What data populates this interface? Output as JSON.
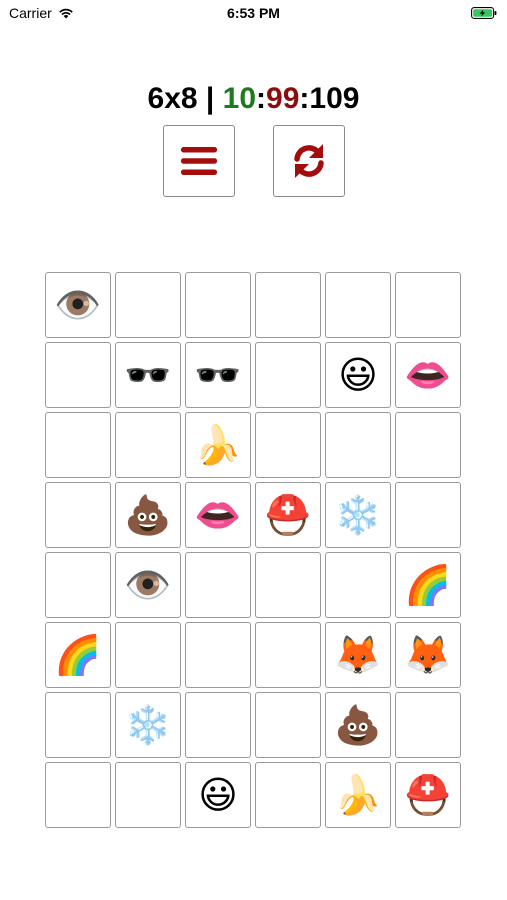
{
  "status_bar": {
    "carrier": "Carrier",
    "time": "6:53 PM",
    "battery_color": "#35c759"
  },
  "header": {
    "grid_size": "6x8",
    "separator": " | ",
    "timer_green": "10",
    "colon1": ":",
    "timer_red": "99",
    "colon2": ":",
    "timer_black": "109",
    "green_color": "#1f7a1f",
    "red_color": "#8b0d0d"
  },
  "toolbar": {
    "menu_icon": "hamburger-icon",
    "refresh_icon": "refresh-icon",
    "icon_color": "#a30d0d"
  },
  "board": {
    "columns": 6,
    "rows": 8,
    "cells": [
      [
        "👁️",
        "",
        "",
        "",
        "",
        ""
      ],
      [
        "",
        "🕶️",
        "🕶️",
        "",
        "😃",
        "👄"
      ],
      [
        "",
        "",
        "🍌",
        "",
        "",
        ""
      ],
      [
        "",
        "💩",
        "👄",
        "⛑️",
        "❄️",
        ""
      ],
      [
        "",
        "👁️",
        "",
        "",
        "",
        "🌈"
      ],
      [
        "🌈",
        "",
        "",
        "",
        "🦊",
        "🦊"
      ],
      [
        "",
        "❄️",
        "",
        "",
        "💩",
        ""
      ],
      [
        "",
        "",
        "😃",
        "",
        "🍌",
        "⛑️"
      ]
    ]
  }
}
